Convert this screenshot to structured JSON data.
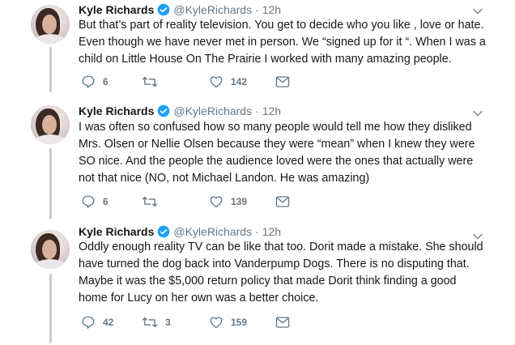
{
  "tweets": [
    {
      "name": "Kyle Richards",
      "handle": "@KyleRichards",
      "separator": "·",
      "time": "12h",
      "lines": [
        "But that’s part of reality television. You get to decide who you like , love or hate.",
        "Even though we have never met in person. We “signed up for it “. When I was a",
        "child on Little House On The Prairie I worked with many amazing people."
      ],
      "replies": "6",
      "retweets": "",
      "likes": "142"
    },
    {
      "name": "Kyle Richards",
      "handle": "@KyleRichards",
      "separator": "·",
      "time": "12h",
      "lines": [
        "I was often so confused how so many people would tell me how they disliked",
        "Mrs. Olsen or Nellie Olsen because they were “mean” when I knew they were",
        "SO nice. And the people the audience loved were the ones that actually were",
        "not that nice (NO, not Michael Landon. He was amazing)"
      ],
      "replies": "6",
      "retweets": "",
      "likes": "139"
    },
    {
      "name": "Kyle Richards",
      "handle": "@KyleRichards",
      "separator": "·",
      "time": "12h",
      "lines": [
        "Oddly enough reality TV can be like that too. Dorit made a mistake. She should",
        "have turned the dog back into Vanderpump Dogs. There is no disputing that.",
        "Maybe it was the $5,000 return policy that made Dorit think finding a good",
        "home for Lucy on her own was a better choice."
      ],
      "replies": "42",
      "retweets": "3",
      "likes": "159"
    }
  ],
  "icons": {
    "verified": "verified-badge-icon",
    "caret": "chevron-down-icon",
    "reply": "reply-icon",
    "retweet": "retweet-icon",
    "like": "heart-icon",
    "dm": "envelope-icon"
  },
  "colors": {
    "text": "#14171a",
    "secondary": "#657786",
    "verified": "#1da1f2",
    "thread_line": "#c4cfd6"
  }
}
